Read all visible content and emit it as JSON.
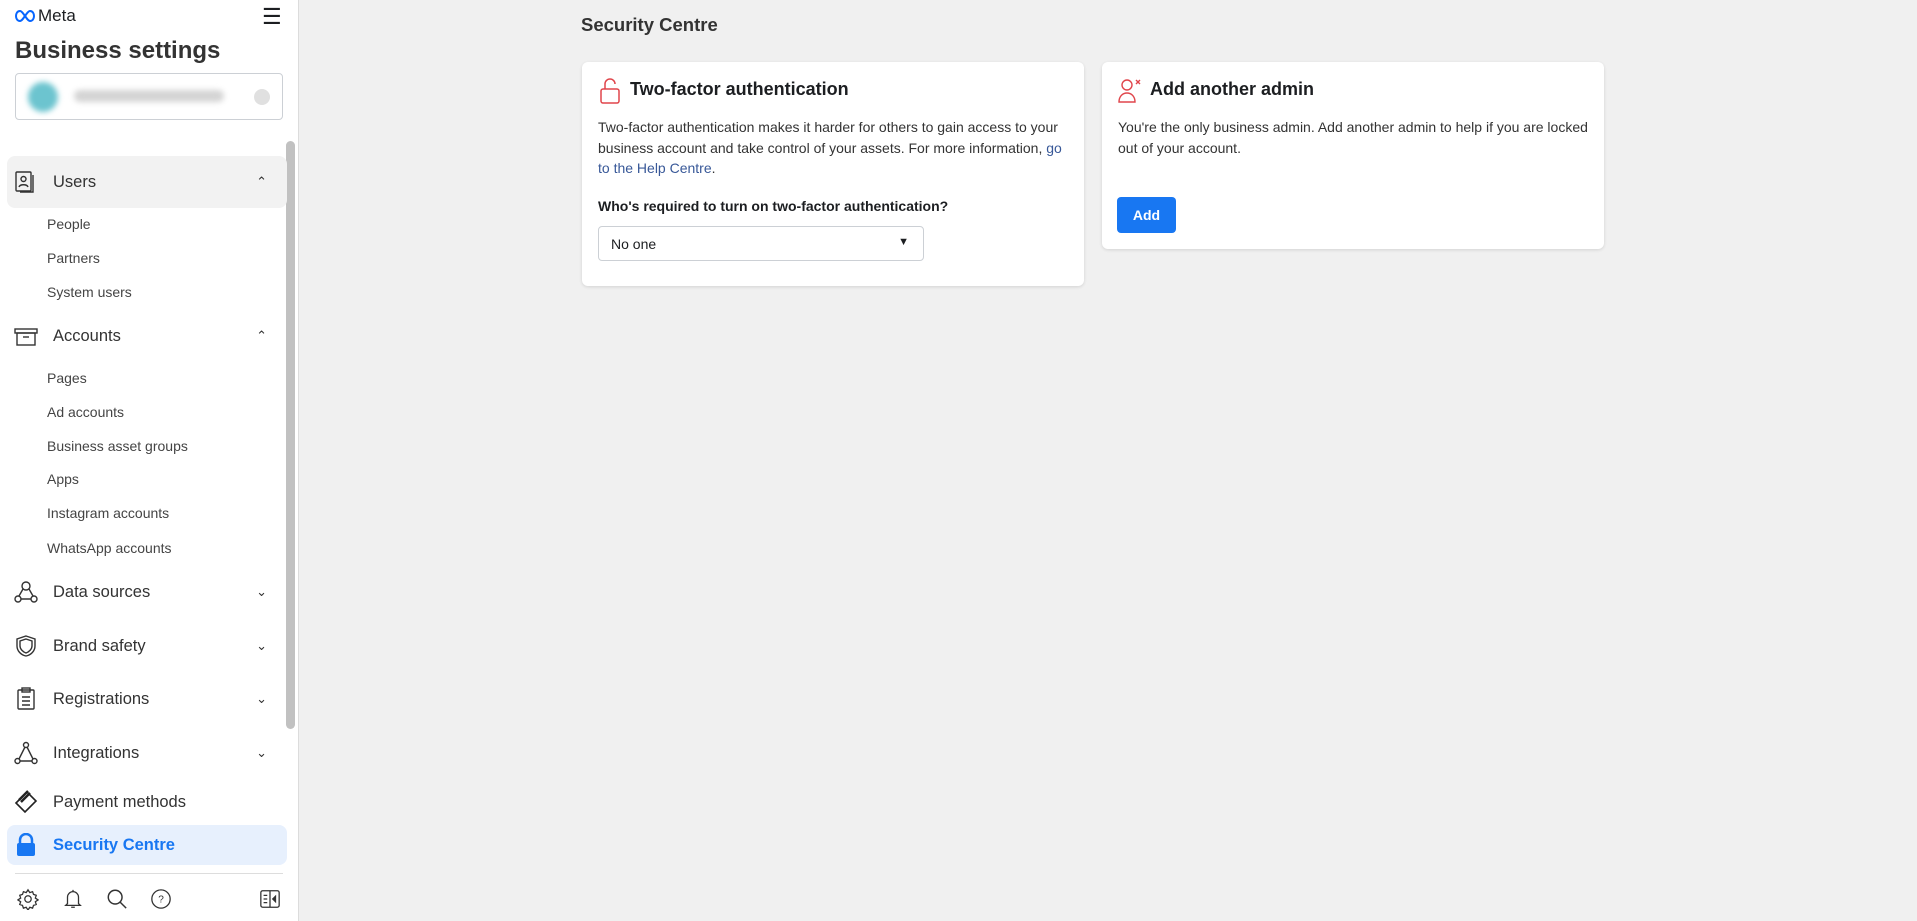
{
  "app": {
    "logo": "Meta",
    "title": "Business settings",
    "accent": "#1877f2"
  },
  "sidebar": {
    "users": {
      "label": "Users",
      "items": [
        "People",
        "Partners",
        "System users"
      ]
    },
    "accounts": {
      "label": "Accounts",
      "items": [
        "Pages",
        "Ad accounts",
        "Business asset groups",
        "Apps",
        "Instagram accounts",
        "WhatsApp accounts"
      ]
    },
    "data_sources": "Data sources",
    "brand_safety": "Brand safety",
    "registrations": "Registrations",
    "integrations": "Integrations",
    "payment_methods": "Payment methods",
    "security_centre": "Security Centre"
  },
  "main": {
    "title": "Security Centre",
    "tfa": {
      "title": "Two-factor authentication",
      "text": "Two-factor authentication makes it harder for others to gain access to your business account and take control of your assets. For more information, ",
      "link": "go to the Help Centre",
      "link_end": ".",
      "question": "Who's required to turn on two-factor authentication?",
      "value": "No one"
    },
    "admin": {
      "title": "Add another admin",
      "text": "You're the only business admin. Add another admin to help if you are locked out of your account.",
      "button": "Add"
    }
  }
}
